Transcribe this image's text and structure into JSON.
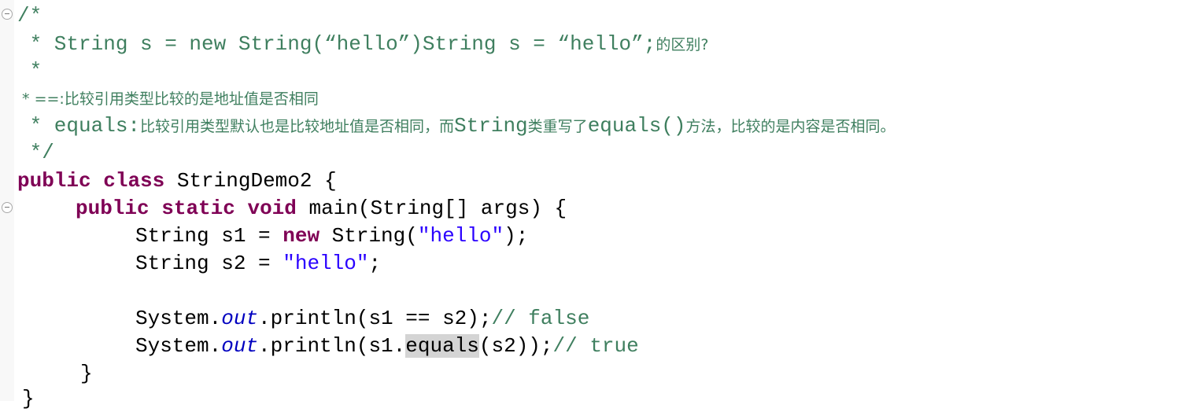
{
  "editor": {
    "comment": {
      "open": "/*",
      "line1_code": " * String s = new String(“hello”)String s = “hello”;",
      "line1_cjk": "的区别?",
      "line2": " *",
      "line3_prefix": " * ==:",
      "line3_cjk": "比较引用类型比较的是地址值是否相同",
      "line4_prefix": " * equals:",
      "line4_cjk_a": "比较引用类型默认也是比较地址值是否相同，而",
      "line4_mid": "String",
      "line4_cjk_b": "类重写了",
      "line4_mid2": "equals()",
      "line4_cjk_c": "方法，比较的是内容是否相同。",
      "close": " */"
    },
    "class_decl": {
      "kw_public": "public",
      "kw_class": "class",
      "name": " StringDemo2 {"
    },
    "main_decl": {
      "kw_public": "public",
      "kw_static": "static",
      "kw_void": "void",
      "rest": " main(String[] args) {"
    },
    "s1_line": {
      "pre": "String s1 = ",
      "kw_new": "new",
      "mid": " String(",
      "str": "\"hello\"",
      "post": ");"
    },
    "s2_line": {
      "pre": "String s2 = ",
      "str": "\"hello\"",
      "post": ";"
    },
    "print1": {
      "pre": "System.",
      "field": "out",
      "mid": ".println(s1 == s2);",
      "comment": "// false"
    },
    "print2": {
      "pre": "System.",
      "field": "out",
      "mid": ".println(s1.",
      "hl": "equals",
      "post": "(s2));",
      "comment": "// true"
    },
    "close_method": "}",
    "close_class": "}"
  },
  "colors": {
    "comment": "#3f7f5f",
    "keyword": "#7f0055",
    "string": "#2a00ff",
    "field": "#0000c0",
    "highlight": "#d4d4d4"
  }
}
